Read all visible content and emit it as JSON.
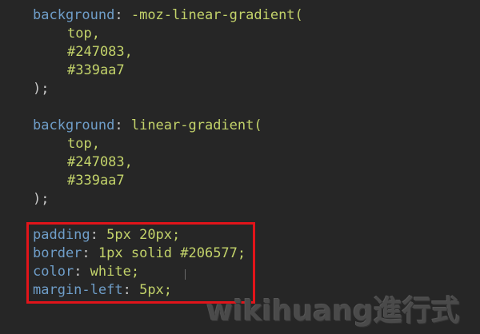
{
  "editor": {
    "colors": {
      "background": "#262626",
      "property": "#6f9ec9",
      "value": "#c3d36a",
      "punctuation": "#c9c9c9",
      "highlight_border": "#e1141a"
    },
    "block1": {
      "prop": "background",
      "sep": ":",
      "fn": " -moz-linear-gradient(",
      "arg1": "top,",
      "arg2": "#247083,",
      "arg3": "#339aa7",
      "close": ");"
    },
    "block2": {
      "prop": "background",
      "sep": ":",
      "fn": " linear-gradient(",
      "arg1": "top,",
      "arg2": "#247083,",
      "arg3": "#339aa7",
      "close": ");"
    },
    "highlighted": [
      {
        "prop": "padding",
        "sep": ":",
        "value": " 5px 20px;"
      },
      {
        "prop": "border",
        "sep": ":",
        "value": " 1px solid #206577;"
      },
      {
        "prop": "color",
        "sep": ":",
        "value": " white;"
      },
      {
        "prop": "margin-left",
        "sep": ":",
        "value": " 5px;"
      }
    ]
  },
  "watermark": "wikihuang進行式"
}
